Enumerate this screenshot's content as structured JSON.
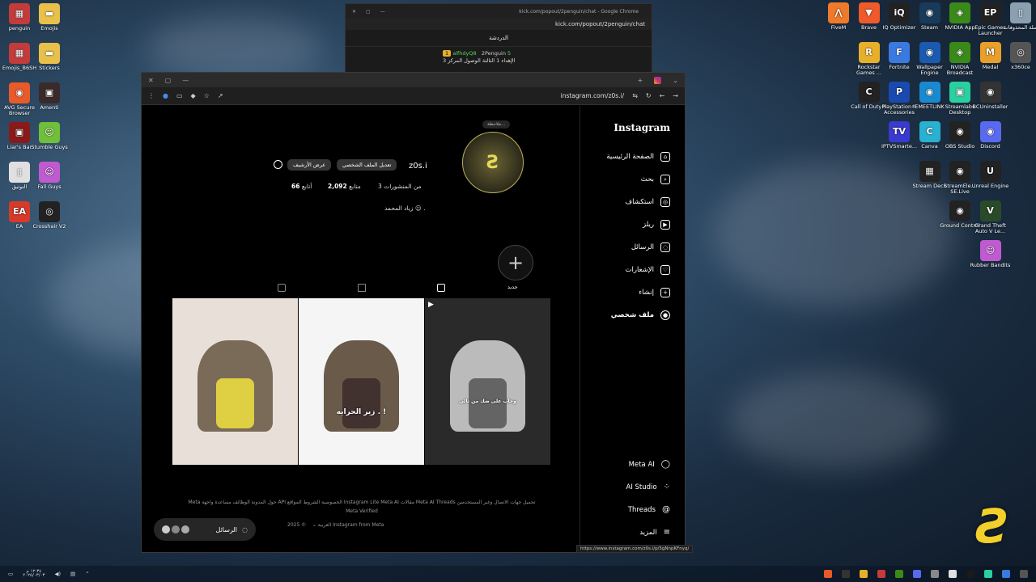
{
  "desktop_left": [
    {
      "label": "penguin",
      "color": "#c33b3b",
      "glyph": "▦"
    },
    {
      "label": "Emojis",
      "color": "#e8c04a",
      "glyph": "▬"
    },
    {
      "label": "Emojis_B6SH",
      "color": "#c33b3b",
      "glyph": "▦"
    },
    {
      "label": "Stickers",
      "color": "#e8c04a",
      "glyph": "▬"
    },
    {
      "label": "AVG Secure Browser",
      "color": "#e85a2a",
      "glyph": "◉"
    },
    {
      "label": "Amenti",
      "color": "#3a2a2a",
      "glyph": "▣"
    },
    {
      "label": "Liar's Bar",
      "color": "#8a1a1a",
      "glyph": "▣"
    },
    {
      "label": "Stumble Guys",
      "color": "#6fbf3a",
      "glyph": "☺"
    },
    {
      "label": "التوثيق",
      "color": "#e0e0e0",
      "glyph": "▯"
    },
    {
      "label": "Fall Guys",
      "color": "#c05ad0",
      "glyph": "☺"
    },
    {
      "label": "EA",
      "color": "#d83a2a",
      "glyph": "EA"
    },
    {
      "label": "Crosshair V2",
      "color": "#222",
      "glyph": "◎"
    }
  ],
  "desktop_right": [
    {
      "label": "FiveM",
      "color": "#f07a2a",
      "glyph": "⋀"
    },
    {
      "label": "Brave",
      "color": "#f05a2a",
      "glyph": "▼"
    },
    {
      "label": "IQ Optimizer",
      "color": "#222",
      "glyph": "iQ"
    },
    {
      "label": "Steam",
      "color": "#1a3a5a",
      "glyph": "◉"
    },
    {
      "label": "NVIDIA App",
      "color": "#3a8a1a",
      "glyph": "◈"
    },
    {
      "label": "Epic Games Launcher",
      "color": "#222",
      "glyph": "EP"
    },
    {
      "label": "سلة المحذوفات",
      "color": "#8aa0b0",
      "glyph": "▯"
    },
    {
      "label": "Rockstar Games ...",
      "color": "#e8b02a",
      "glyph": "R"
    },
    {
      "label": "Fortnite",
      "color": "#3a7ae0",
      "glyph": "F"
    },
    {
      "label": "Wallpaper Engine",
      "color": "#1a5ab0",
      "glyph": "◉"
    },
    {
      "label": "NVIDIA Broadcast",
      "color": "#3a8a1a",
      "glyph": "◈"
    },
    {
      "label": "Medal",
      "color": "#e8a02a",
      "glyph": "M"
    },
    {
      "label": "x360ce",
      "color": "#555",
      "glyph": "◎"
    },
    {
      "label": "Call of Duty®",
      "color": "#222",
      "glyph": "C"
    },
    {
      "label": "PlayStation® Accessories",
      "color": "#1a4ab0",
      "glyph": "P"
    },
    {
      "label": "EMEETLINK",
      "color": "#1a8ad0",
      "glyph": "◉"
    },
    {
      "label": "Streamlabs Desktop",
      "color": "#2ad0a0",
      "glyph": "▣"
    },
    {
      "label": "BCUninstaller",
      "color": "#333",
      "glyph": "◉"
    },
    {
      "label": "IPTVSmarte...",
      "color": "#3a3ad0",
      "glyph": "TV"
    },
    {
      "label": "Canva",
      "color": "#2ab0d0",
      "glyph": "C"
    },
    {
      "label": "OBS Studio",
      "color": "#222",
      "glyph": "◉"
    },
    {
      "label": "Discord",
      "color": "#5a6af0",
      "glyph": "◉"
    },
    {
      "label": "Stream Deck",
      "color": "#222",
      "glyph": "▦"
    },
    {
      "label": "StreamEle... SE.Live",
      "color": "#222",
      "glyph": "◉"
    },
    {
      "label": "Unreal Engine",
      "color": "#222",
      "glyph": "U"
    },
    {
      "label": "Ground Control",
      "color": "#222",
      "glyph": "◉"
    },
    {
      "label": "Grand Theft Auto V Le...",
      "color": "#2a4a2a",
      "glyph": "V"
    },
    {
      "label": "Rubber Bandits",
      "color": "#c05ad0",
      "glyph": "☺"
    }
  ],
  "chat_window": {
    "title": "kick.com/popout/2penguin/chat - Google Chrome",
    "url": "kick.com/popout/2penguin/chat",
    "heading": "الدردشة",
    "user1": "alfhdyQ8",
    "user2": "2Penguin",
    "badge1": "1",
    "badge2": "5",
    "message": "3 الإهداء 1 الثالثة الوصول المركز"
  },
  "browser": {
    "url": "instagram.com/z0s.i/",
    "status_url": "https://www.instagram.com/z0s.i/p/5gNnpKFnyq/"
  },
  "sidebar": {
    "logo": "Instagram",
    "items": [
      {
        "label": "الصفحة الرئيسية",
        "icon": "home-icon",
        "glyph": "⌂"
      },
      {
        "label": "بحث",
        "icon": "search-icon",
        "glyph": "⌕"
      },
      {
        "label": "استكشاف",
        "icon": "explore-icon",
        "glyph": "◎"
      },
      {
        "label": "ريلز",
        "icon": "reels-icon",
        "glyph": "▶"
      },
      {
        "label": "الرسائل",
        "icon": "messenger-icon",
        "glyph": "◌"
      },
      {
        "label": "الإشعارات",
        "icon": "heart-icon",
        "glyph": "♡"
      },
      {
        "label": "إنشاء",
        "icon": "create-icon",
        "glyph": "+"
      },
      {
        "label": "ملف شخصي",
        "icon": "profile-icon",
        "glyph": "●"
      }
    ],
    "bottom_items": [
      {
        "label": "Meta AI",
        "icon": "meta-ai-icon",
        "glyph": "◯"
      },
      {
        "label": "AI Studio",
        "icon": "ai-studio-icon",
        "glyph": "⁘"
      },
      {
        "label": "Threads",
        "icon": "threads-icon",
        "glyph": "@"
      },
      {
        "label": "المزيد",
        "icon": "menu-icon",
        "glyph": "≡"
      }
    ]
  },
  "profile": {
    "username": "z0s.i",
    "note": "ملاحظة...",
    "edit_profile": "تعديل الملف الشخصي",
    "view_archive": "عرض الأرشيف",
    "posts_label": "3 من المنشورات",
    "followers_value": "2,092",
    "followers_label": "متابع",
    "following_value": "66",
    "following_label": "أتابع",
    "full_name": "زياد المحمد ☺ .",
    "new_highlight": "جديد",
    "avatar_glyph": "Ƨ"
  },
  "posts": [
    {
      "colors": [
        "#e8e0d8",
        "#7a6a58",
        "#f0e040"
      ],
      "caption": ""
    },
    {
      "colors": [
        "#f5f5f5",
        "#6a5a4a",
        "#3a2a2a"
      ],
      "caption": "زير الحرايه . !"
    },
    {
      "colors": [
        "#2a2a2a",
        "#bbbbbb",
        "#555555"
      ],
      "caption": "وحاب على ضك من تالي"
    }
  ],
  "footer": {
    "links": "Meta  حول  المدونة  الوظائف  مساعدة  واجهة API  الخصوصية  الشروط  المواقع  Instagram Lite  Meta AI  مقالات Meta AI  Threads  تحميل جهات الاتصال وغير المستخدمين",
    "verified": "Meta Verified",
    "language": "العربية",
    "copyright": "© 2025 Instagram from Meta"
  },
  "messages_pill": {
    "label": "الرسائل"
  },
  "taskbar": {
    "time": "١٢:٣٤ م",
    "date": "٢٠٢٥/٠٣/٠٣"
  },
  "colors": {
    "brand": "#f2cf2a",
    "ig_bg": "#000000"
  }
}
